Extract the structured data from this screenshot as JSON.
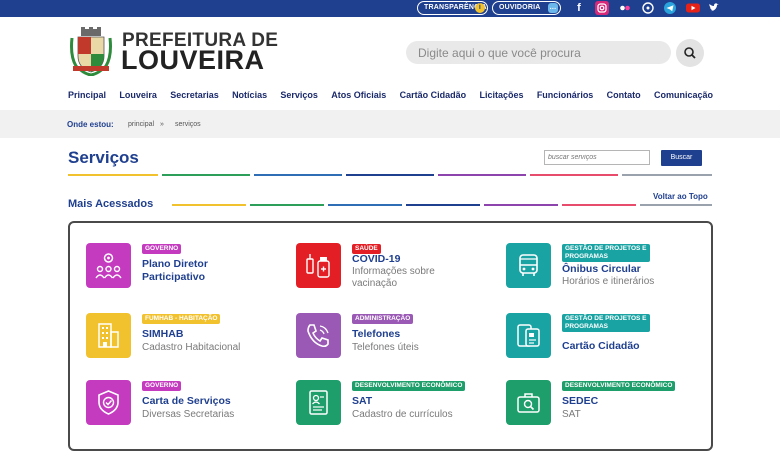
{
  "topbar": {
    "transparencia_label": "TRANSPARÊNCIA",
    "ouvidoria_label": "OUVIDORIA"
  },
  "header": {
    "logo_line1": "PREFEITURA DE",
    "logo_line2": "LOUVEIRA",
    "search_placeholder": "Digite aqui o que você procura"
  },
  "nav": {
    "items": [
      "Principal",
      "Louveira",
      "Secretarias",
      "Notícias",
      "Serviços",
      "Atos Oficiais",
      "Cartão Cidadão",
      "Licitações",
      "Funcionários",
      "Contato",
      "Comunicação"
    ]
  },
  "breadcrumb": {
    "label": "Onde estou:",
    "items": [
      "principal",
      "serviços"
    ],
    "separator": "»"
  },
  "page": {
    "title": "Serviços",
    "filter_placeholder": "buscar serviços",
    "filter_button": "Buscar",
    "section_title": "Mais Acessados",
    "back_to_top": "Voltar ao Topo"
  },
  "colors": {
    "brand_blue": "#1f3f8f",
    "stripe": [
      "#f2c12e",
      "#2e9e5b",
      "#2f6db5",
      "#1f3f8f",
      "#8e44ad",
      "#e74c6c",
      "#9aa3ad"
    ]
  },
  "services": [
    {
      "badge": "GOVERNO",
      "title": "Plano Diretor",
      "title2": "Participativo",
      "sub": "",
      "sub2": "",
      "icon": "people-gear-icon",
      "color": "#c43bbf",
      "badge_color": "#c43bbf"
    },
    {
      "badge": "SAÚDE",
      "title": "COVID-19",
      "title2": "",
      "sub": "Informações sobre",
      "sub2": "vacinação",
      "icon": "vaccine-icon",
      "color": "#e31e24",
      "badge_color": "#e31e24"
    },
    {
      "badge": "GESTÃO DE PROJETOS E",
      "badge2": "PROGRAMAS",
      "title": "Ônibus Circular",
      "title2": "",
      "sub": "Horários e itinerários",
      "sub2": "",
      "icon": "bus-icon",
      "color": "#1aa3a3",
      "badge_color": "#1aa3a3"
    },
    {
      "badge": "FUMHAB - HABITAÇÃO",
      "title": "SIMHAB",
      "title2": "",
      "sub": "Cadastro Habitacional",
      "sub2": "",
      "icon": "building-icon",
      "color": "#f2c12e",
      "badge_color": "#f2c12e"
    },
    {
      "badge": "ADMINISTRAÇÃO",
      "title": "Telefones",
      "title2": "",
      "sub": "Telefones úteis",
      "sub2": "",
      "icon": "phone-icon",
      "color": "#9b59b6",
      "badge_color": "#9b59b6"
    },
    {
      "badge": "GESTÃO DE PROJETOS E",
      "badge2": "PROGRAMAS",
      "title": "Cartão Cidadão",
      "title2": "",
      "sub": "",
      "sub2": "",
      "icon": "card-icon",
      "color": "#1aa3a3",
      "badge_color": "#1aa3a3"
    },
    {
      "badge": "GOVERNO",
      "title": "Carta de Serviços",
      "title2": "",
      "sub": "Diversas Secretarias",
      "sub2": "",
      "icon": "shield-check-icon",
      "color": "#c43bbf",
      "badge_color": "#c43bbf"
    },
    {
      "badge": "DESENVOLVIMENTO ECONÔMICO",
      "title": "SAT",
      "title2": "",
      "sub": "Cadastro de currículos",
      "sub2": "",
      "icon": "resume-icon",
      "color": "#1e9e6a",
      "badge_color": "#1e9e6a"
    },
    {
      "badge": "DESENVOLVIMENTO ECONÔMICO",
      "title": "SEDEC",
      "title2": "",
      "sub": "SAT",
      "sub2": "",
      "icon": "briefcase-search-icon",
      "color": "#1e9e6a",
      "badge_color": "#1e9e6a"
    }
  ]
}
